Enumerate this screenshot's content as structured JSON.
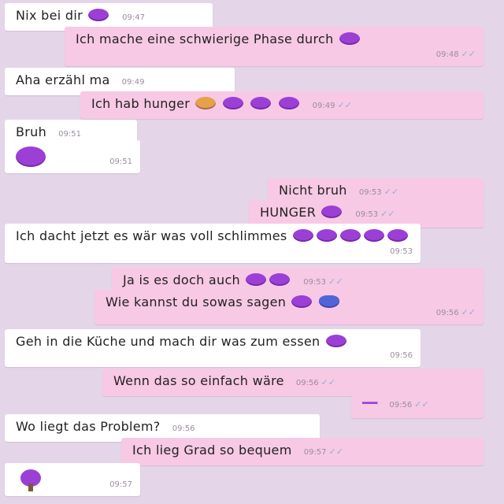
{
  "colors": {
    "incoming_bubble": "#ffffff",
    "outgoing_bubble": "#f7c9e4",
    "background": "#e4d6e8",
    "emoji": "#9b3fd6"
  },
  "messages": [
    {
      "text": "Nix bei dir",
      "time": "09:47",
      "dir": "in"
    },
    {
      "text": "Ich mache eine schwierige Phase durch",
      "time": "09:48",
      "dir": "out"
    },
    {
      "text": "Aha erzähl ma",
      "time": "09:49",
      "dir": "in"
    },
    {
      "text": "Ich hab hunger",
      "time": "09:49",
      "dir": "out"
    },
    {
      "text": "Bruh",
      "time": "09:51",
      "dir": "in"
    },
    {
      "text": "",
      "time": "09:51",
      "dir": "in"
    },
    {
      "text": "Nicht bruh",
      "time": "09:53",
      "dir": "out"
    },
    {
      "text": "HUNGER",
      "time": "09:53",
      "dir": "out"
    },
    {
      "text": "Ich dacht jetzt es wär was voll schlimmes",
      "time": "09:53",
      "dir": "in"
    },
    {
      "text": "Ja is es doch auch",
      "time": "09:53",
      "dir": "out"
    },
    {
      "text": "Wie kannst du sowas sagen",
      "time": "09:56",
      "dir": "out"
    },
    {
      "text": "Geh in die Küche und mach dir was zum essen",
      "time": "09:56",
      "dir": "in"
    },
    {
      "text": "Wenn das so einfach wäre",
      "time": "09:56",
      "dir": "out"
    },
    {
      "text": "",
      "time": "09:56",
      "dir": "out"
    },
    {
      "text": "Wo liegt das Problem?",
      "time": "09:56",
      "dir": "in"
    },
    {
      "text": "Ich lieg Grad so bequem",
      "time": "09:57",
      "dir": "out"
    },
    {
      "text": "",
      "time": "09:57",
      "dir": "in"
    }
  ]
}
